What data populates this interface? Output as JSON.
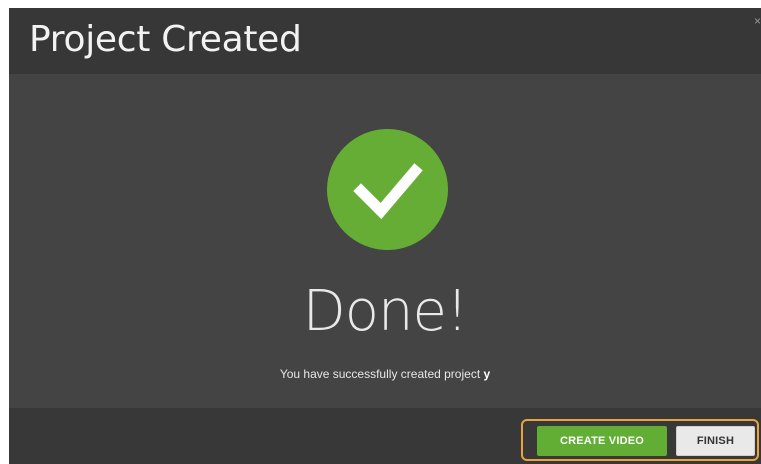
{
  "dialog": {
    "title": "Project Created",
    "close_label": "×"
  },
  "body": {
    "status_icon": "checkmark-icon",
    "done_text": "Done!",
    "message_prefix": "You have successfully created project ",
    "project_name": "y"
  },
  "footer": {
    "create_video_label": "CREATE VIDEO",
    "finish_label": "FINISH"
  },
  "colors": {
    "accent_green": "#66ad35",
    "highlight_orange": "#e8a33d",
    "header_bg": "#373737",
    "body_bg": "#444444"
  }
}
